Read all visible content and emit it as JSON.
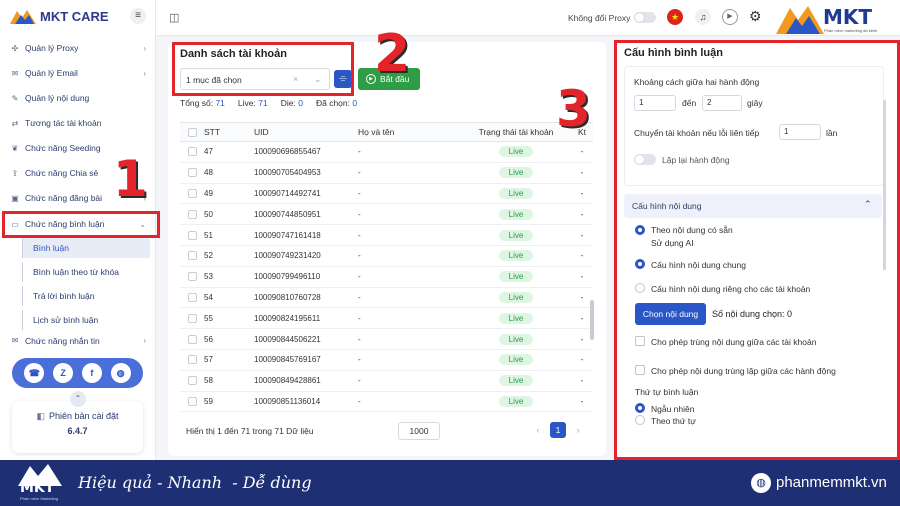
{
  "brand": {
    "name": "MKT CARE",
    "menu_icon": "≡"
  },
  "sidebar": {
    "items": [
      {
        "label": "Quản lý Proxy",
        "icon": "✣",
        "chevron": "›"
      },
      {
        "label": "Quản lý Email",
        "icon": "✉",
        "chevron": "›"
      },
      {
        "label": "Quản lý nội dung",
        "icon": "✎",
        "chevron": ""
      },
      {
        "label": "Tương tác tài khoản",
        "icon": "⇄",
        "chevron": ""
      },
      {
        "label": "Chức năng Seeding",
        "icon": "❦",
        "chevron": ""
      },
      {
        "label": "Chức năng Chia sẻ",
        "icon": "⇪",
        "chevron": ""
      },
      {
        "label": "Chức năng đăng bài",
        "icon": "▣",
        "chevron": "›"
      },
      {
        "label": "Chức năng bình luận",
        "icon": "▭",
        "chevron": "⌄"
      },
      {
        "label": "Chức năng nhắn tin",
        "icon": "✉",
        "chevron": "›"
      }
    ],
    "sub_items": [
      "Bình luận",
      "Bình luận theo từ khóa",
      "Trả lời bình luận",
      "Lịch sử bình luận"
    ],
    "version_label": "Phiên bản cài đặt",
    "version_value": "6.4.7",
    "version_icon": "◧"
  },
  "topbar": {
    "layout_icon": "◫",
    "proxy_toggle_label": "Không đổi Proxy",
    "overlay_logo_text": "MKT",
    "overlay_logo_sub": "Phần mềm marketing đa kênh"
  },
  "accounts": {
    "title": "Danh sách tài khoản",
    "select_value": "1 mục đã chọn",
    "start_label": "Bắt đầu",
    "stats": [
      {
        "label": "Tổng số:",
        "value": "71"
      },
      {
        "label": "Live:",
        "value": "71"
      },
      {
        "label": "Die:",
        "value": "0"
      },
      {
        "label": "Đã chọn:",
        "value": "0"
      }
    ],
    "columns": [
      "STT",
      "UID",
      "Họ và tên",
      "Trạng thái tài khoản",
      "Kt"
    ],
    "rows": [
      {
        "stt": "47",
        "uid": "100090696855467",
        "name": "-",
        "status": "Live",
        "kt": "-"
      },
      {
        "stt": "48",
        "uid": "100090705404953",
        "name": "-",
        "status": "Live",
        "kt": "-"
      },
      {
        "stt": "49",
        "uid": "100090714492741",
        "name": "-",
        "status": "Live",
        "kt": "-"
      },
      {
        "stt": "50",
        "uid": "100090744850951",
        "name": "-",
        "status": "Live",
        "kt": "-"
      },
      {
        "stt": "51",
        "uid": "100090747161418",
        "name": "-",
        "status": "Live",
        "kt": "-"
      },
      {
        "stt": "52",
        "uid": "100090749231420",
        "name": "-",
        "status": "Live",
        "kt": "-"
      },
      {
        "stt": "53",
        "uid": "100090799496110",
        "name": "-",
        "status": "Live",
        "kt": "-"
      },
      {
        "stt": "54",
        "uid": "100090810760728",
        "name": "-",
        "status": "Live",
        "kt": "-"
      },
      {
        "stt": "55",
        "uid": "100090824195611",
        "name": "-",
        "status": "Live",
        "kt": "-"
      },
      {
        "stt": "56",
        "uid": "100090844506221",
        "name": "-",
        "status": "Live",
        "kt": "-"
      },
      {
        "stt": "57",
        "uid": "100090845769167",
        "name": "-",
        "status": "Live",
        "kt": "-"
      },
      {
        "stt": "58",
        "uid": "100090849428861",
        "name": "-",
        "status": "Live",
        "kt": "-"
      },
      {
        "stt": "59",
        "uid": "100090851136014",
        "name": "-",
        "status": "Live",
        "kt": "-"
      }
    ],
    "pagination_text": "Hiển thị 1 đến 71 trong 71 Dữ liệu",
    "page_size": "1000",
    "current_page": "1",
    "prev": "‹",
    "next": "›"
  },
  "config": {
    "title": "Cấu hình bình luận",
    "delay_label": "Khoảng cách giữa hai hành động",
    "delay_from": "1",
    "delay_to_label": "đến",
    "delay_to": "2",
    "delay_unit": "giây",
    "switch_label": "Chuyển tài khoản nếu lỗi liên tiếp",
    "switch_value": "1",
    "switch_unit": "lần",
    "repeat_label": "Lặp lại hành động",
    "content_section": "Cấu hình nội dung",
    "opt_existing": "Theo nội dung có sẵn",
    "opt_ai": "Sử dụng AI",
    "opt_general": "Cấu hình nội dung chung",
    "opt_per_account": "Cấu hình nội dung riêng cho các tài khoản",
    "choose_button": "Chọn nội dung",
    "chosen_count_label": "Số nội dung chọn: 0",
    "allow_dup_accounts": "Cho phép trùng nội dung giữa các tài khoản",
    "allow_dup_actions": "Cho phép nội dung trùng lặp giữa các hành động",
    "order_label": "Thứ tự bình luận",
    "order_random": "Ngẫu nhiên",
    "order_sequential": "Theo thứ tự"
  },
  "annotations": [
    "1",
    "2",
    "3"
  ],
  "footer": {
    "logo": "MKT",
    "logo_sub": "Phần mềm Marketing",
    "slogan": "Hiệu quả - Nhanh  - Dễ dùng",
    "website": "phanmemmkt.vn"
  },
  "colors": {
    "accent": "#2b56c6",
    "live_bg": "#dff5e3",
    "live_text": "#2a9b44",
    "annotation": "#e3242b",
    "start_button": "#2e9e46",
    "footer_bg": "#1f2f73"
  }
}
